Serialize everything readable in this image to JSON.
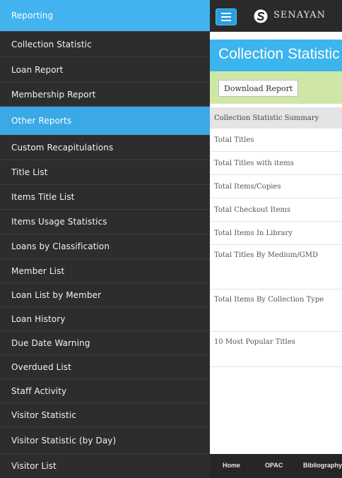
{
  "sidebar": {
    "items": [
      {
        "label": "Reporting",
        "section": true
      },
      {
        "label": "Collection Statistic"
      },
      {
        "label": "Loan Report"
      },
      {
        "label": "Membership Report"
      },
      {
        "label": "Other Reports",
        "section": true
      },
      {
        "label": "Custom Recapitulations"
      },
      {
        "label": "Title List"
      },
      {
        "label": "Items Title List"
      },
      {
        "label": "Items Usage Statistics"
      },
      {
        "label": "Loans by Classification"
      },
      {
        "label": "Member List"
      },
      {
        "label": "Loan List by Member"
      },
      {
        "label": "Loan History"
      },
      {
        "label": "Due Date Warning"
      },
      {
        "label": "Overdued List"
      },
      {
        "label": "Staff Activity"
      },
      {
        "label": "Visitor Statistic"
      },
      {
        "label": "Visitor Statistic (by Day)"
      },
      {
        "label": "Visitor List"
      }
    ]
  },
  "topbar": {
    "brand": "SENAYAN",
    "menu_icon": "hamburger-icon",
    "logo_icon": "senayan-logo-icon"
  },
  "main": {
    "title": "Collection Statistic",
    "download_label": "Download Report",
    "summary_header": "Collection Statistic Summary",
    "rows": [
      "Total Titles",
      "Total Titles with items",
      "Total Items/Copies",
      "Total Checkout Items",
      "Total Items In Library",
      "Total Titles By Medium/GMD",
      "Total Items By Collection Type",
      "10 Most Popular Titles"
    ]
  },
  "footer": {
    "links": [
      "Home",
      "OPAC",
      "Bibliography"
    ]
  },
  "colors": {
    "sidebar_bg": "#2d2d2d",
    "accent": "#3aa9e6",
    "action_band": "#cfe7a6"
  }
}
